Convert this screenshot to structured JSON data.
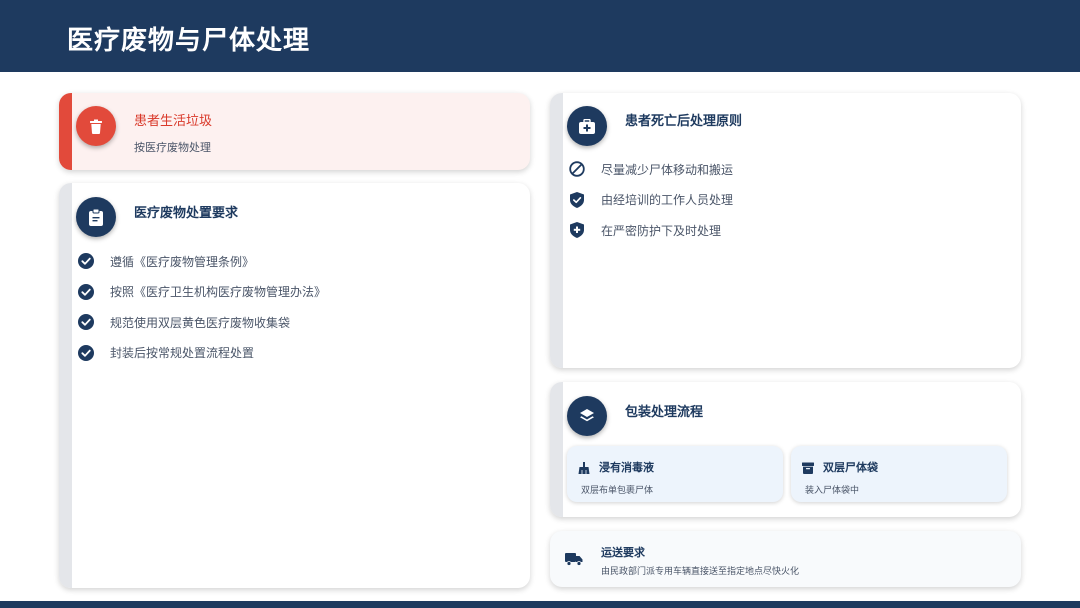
{
  "page_title": "医疗废物与尸体处理",
  "colors": {
    "primary": "#1e3a5f",
    "alert": "#e24a3b",
    "text": "#4a5568"
  },
  "patient_trash": {
    "icon": "trash-icon",
    "title": "患者生活垃圾",
    "subtitle": "按医疗废物处理"
  },
  "waste_requirements": {
    "icon": "clipboard-icon",
    "title": "医疗废物处置要求",
    "items": [
      "遵循《医疗废物管理条例》",
      "按照《医疗卫生机构医疗废物管理办法》",
      "规范使用双层黄色医疗废物收集袋",
      "封装后按常规处置流程处置"
    ],
    "item_icon": "check-circle-icon"
  },
  "death_principles": {
    "icon": "medical-kit-icon",
    "title": "患者死亡后处理原则",
    "items": [
      {
        "icon": "ban-icon",
        "text": "尽量减少尸体移动和搬运"
      },
      {
        "icon": "shield-check-icon",
        "text": "由经培训的工作人员处理"
      },
      {
        "icon": "shield-plus-icon",
        "text": "在严密防护下及时处理"
      }
    ]
  },
  "packaging": {
    "icon": "layers-icon",
    "title": "包装处理流程",
    "steps": [
      {
        "icon": "broom-icon",
        "title": "浸有消毒液",
        "subtitle": "双层布单包裹尸体"
      },
      {
        "icon": "archive-box-icon",
        "title": "双层尸体袋",
        "subtitle": "装入尸体袋中"
      }
    ]
  },
  "transport": {
    "icon": "truck-icon",
    "title": "运送要求",
    "subtitle": "由民政部门派专用车辆直接送至指定地点尽快火化"
  }
}
